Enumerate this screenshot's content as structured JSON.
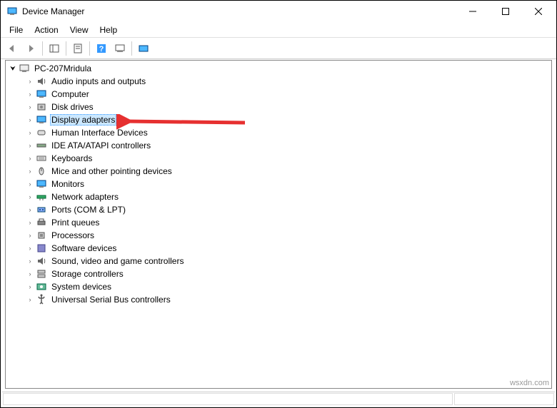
{
  "window": {
    "title": "Device Manager"
  },
  "menu": {
    "file": "File",
    "action": "Action",
    "view": "View",
    "help": "Help"
  },
  "tree": {
    "root": "PC-207Mridula",
    "items": [
      {
        "label": "Audio inputs and outputs",
        "icon": "speaker"
      },
      {
        "label": "Computer",
        "icon": "monitor"
      },
      {
        "label": "Disk drives",
        "icon": "disk"
      },
      {
        "label": "Display adapters",
        "icon": "monitor",
        "highlighted": true
      },
      {
        "label": "Human Interface Devices",
        "icon": "hid"
      },
      {
        "label": "IDE ATA/ATAPI controllers",
        "icon": "ide"
      },
      {
        "label": "Keyboards",
        "icon": "keyboard"
      },
      {
        "label": "Mice and other pointing devices",
        "icon": "mouse"
      },
      {
        "label": "Monitors",
        "icon": "monitor"
      },
      {
        "label": "Network adapters",
        "icon": "network"
      },
      {
        "label": "Ports (COM & LPT)",
        "icon": "port"
      },
      {
        "label": "Print queues",
        "icon": "printer"
      },
      {
        "label": "Processors",
        "icon": "cpu"
      },
      {
        "label": "Software devices",
        "icon": "software"
      },
      {
        "label": "Sound, video and game controllers",
        "icon": "speaker"
      },
      {
        "label": "Storage controllers",
        "icon": "storage"
      },
      {
        "label": "System devices",
        "icon": "system"
      },
      {
        "label": "Universal Serial Bus controllers",
        "icon": "usb"
      }
    ]
  },
  "watermark": "wsxdn.com"
}
